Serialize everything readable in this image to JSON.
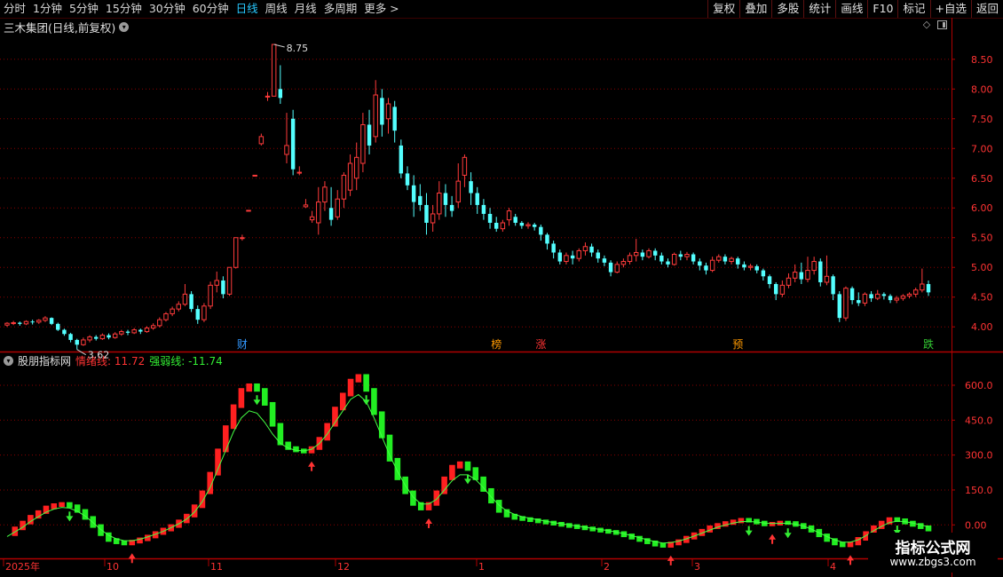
{
  "toolbar": {
    "periods": [
      "分时",
      "1分钟",
      "5分钟",
      "15分钟",
      "30分钟",
      "60分钟",
      "日线",
      "周线",
      "月线",
      "多周期",
      "更多 >"
    ],
    "active_period": "日线",
    "buttons": [
      "复权",
      "叠加",
      "多股",
      "统计",
      "画线",
      "F10",
      "标记",
      "+自选",
      "返回"
    ]
  },
  "main_chart": {
    "title": "三木集团(日线,前复权)",
    "y_ticks": [
      "8.50",
      "8.00",
      "7.50",
      "7.00",
      "6.50",
      "6.00",
      "5.50",
      "5.00",
      "4.50",
      "4.00"
    ],
    "high_label": "8.75",
    "low_label": "3.62",
    "markers": [
      {
        "label": "财",
        "color": "#3399ff"
      },
      {
        "label": "榜",
        "color": "#ff9900"
      },
      {
        "label": "涨",
        "color": "#ff3333"
      },
      {
        "label": "预",
        "color": "#ff9900"
      },
      {
        "label": "跌",
        "color": "#33cc33"
      }
    ],
    "up_color": "#ff3b3b",
    "down_color": "#54ffff"
  },
  "indicator": {
    "name": "股朋指标网",
    "line1_label": "情绪线: 11.72",
    "line2_label": "强弱线: -11.74",
    "y_ticks": [
      "600.0",
      "450.0",
      "300.0",
      "150.0",
      "0.00"
    ],
    "up_color": "#ff2020",
    "down_color": "#22ee22"
  },
  "x_axis_labels": [
    "2025年",
    "10",
    "11",
    "12",
    "1",
    "2",
    "3",
    "4"
  ],
  "watermark": {
    "line1": "指标公式网",
    "line2": "www.zbgs3.com"
  },
  "chart_data": [
    {
      "type": "candlestick",
      "title": "三木集团(日线,前复权)",
      "ylim": [
        3.6,
        8.9
      ],
      "annotations": [
        {
          "text": "8.75",
          "kind": "high"
        },
        {
          "text": "3.62",
          "kind": "low"
        }
      ],
      "points": [
        [
          4.03,
          4.06,
          4.0,
          4.08
        ],
        [
          4.06,
          4.07,
          4.03,
          4.1
        ],
        [
          4.07,
          4.05,
          4.02,
          4.09
        ],
        [
          4.05,
          4.09,
          4.03,
          4.11
        ],
        [
          4.09,
          4.08,
          4.04,
          4.12
        ],
        [
          4.08,
          4.11,
          4.05,
          4.13
        ],
        [
          4.11,
          4.15,
          4.08,
          4.18
        ],
        [
          4.15,
          4.05,
          4.03,
          4.16
        ],
        [
          4.05,
          3.95,
          3.93,
          4.07
        ],
        [
          3.95,
          3.88,
          3.85,
          3.97
        ],
        [
          3.88,
          3.78,
          3.74,
          3.9
        ],
        [
          3.78,
          3.7,
          3.62,
          3.8
        ],
        [
          3.7,
          3.78,
          3.68,
          3.82
        ],
        [
          3.78,
          3.83,
          3.74,
          3.86
        ],
        [
          3.83,
          3.8,
          3.77,
          3.86
        ],
        [
          3.8,
          3.86,
          3.78,
          3.89
        ],
        [
          3.86,
          3.82,
          3.79,
          3.89
        ],
        [
          3.82,
          3.88,
          3.8,
          3.91
        ],
        [
          3.88,
          3.92,
          3.85,
          3.95
        ],
        [
          3.92,
          3.9,
          3.86,
          3.95
        ],
        [
          3.9,
          3.95,
          3.88,
          3.98
        ],
        [
          3.95,
          3.92,
          3.88,
          3.97
        ],
        [
          3.92,
          3.98,
          3.9,
          4.01
        ],
        [
          3.98,
          4.02,
          3.95,
          4.06
        ],
        [
          4.02,
          4.12,
          3.99,
          4.16
        ],
        [
          4.12,
          4.22,
          4.09,
          4.25
        ],
        [
          4.22,
          4.3,
          4.18,
          4.34
        ],
        [
          4.3,
          4.38,
          4.26,
          4.43
        ],
        [
          4.38,
          4.55,
          4.35,
          4.72
        ],
        [
          4.55,
          4.3,
          4.25,
          4.6
        ],
        [
          4.3,
          4.12,
          4.05,
          4.36
        ],
        [
          4.12,
          4.35,
          4.08,
          4.4
        ],
        [
          4.35,
          4.7,
          4.3,
          4.76
        ],
        [
          4.7,
          4.78,
          4.58,
          4.93
        ],
        [
          4.78,
          4.55,
          4.48,
          4.85
        ],
        [
          4.55,
          5.0,
          4.52,
          5.0
        ],
        [
          5.0,
          5.5,
          4.98,
          5.5
        ],
        [
          5.5,
          5.5,
          5.45,
          5.55
        ],
        [
          5.96,
          5.96,
          5.96,
          5.96
        ],
        [
          6.55,
          6.55,
          6.55,
          6.55
        ],
        [
          7.08,
          7.2,
          7.05,
          7.25
        ],
        [
          7.88,
          7.88,
          7.8,
          7.95
        ],
        [
          7.88,
          8.75,
          7.88,
          8.75
        ],
        [
          8.0,
          7.85,
          7.75,
          8.4
        ],
        [
          6.9,
          7.05,
          6.75,
          7.6
        ],
        [
          7.5,
          6.65,
          6.55,
          7.65
        ],
        [
          6.6,
          6.6,
          6.55,
          6.7
        ],
        [
          6.02,
          6.05,
          6.0,
          6.15
        ],
        [
          5.8,
          5.85,
          5.75,
          5.95
        ],
        [
          5.75,
          6.1,
          5.55,
          6.35
        ],
        [
          6.1,
          6.35,
          5.95,
          6.45
        ],
        [
          6.0,
          5.8,
          5.7,
          6.35
        ],
        [
          5.85,
          6.15,
          5.8,
          6.3
        ],
        [
          6.15,
          6.55,
          6.0,
          6.6
        ],
        [
          6.3,
          6.75,
          6.2,
          6.9
        ],
        [
          6.5,
          6.85,
          6.3,
          7.1
        ],
        [
          6.75,
          7.4,
          6.6,
          7.6
        ],
        [
          7.4,
          7.05,
          6.9,
          7.65
        ],
        [
          7.2,
          7.9,
          7.1,
          8.15
        ],
        [
          7.85,
          7.4,
          7.2,
          8.0
        ],
        [
          7.5,
          7.75,
          7.25,
          7.85
        ],
        [
          7.7,
          7.3,
          7.1,
          7.8
        ],
        [
          7.05,
          6.58,
          6.5,
          7.15
        ],
        [
          6.58,
          6.38,
          6.3,
          6.7
        ],
        [
          6.38,
          6.1,
          5.85,
          6.55
        ],
        [
          6.2,
          6.05,
          5.95,
          6.4
        ],
        [
          6.05,
          5.75,
          5.55,
          6.25
        ],
        [
          5.75,
          5.9,
          5.6,
          6.05
        ],
        [
          5.9,
          6.25,
          5.8,
          6.45
        ],
        [
          6.25,
          6.05,
          5.85,
          6.4
        ],
        [
          6.05,
          5.95,
          5.85,
          6.2
        ],
        [
          6.1,
          6.45,
          6.0,
          6.75
        ],
        [
          6.55,
          6.85,
          6.35,
          6.9
        ],
        [
          6.45,
          6.25,
          6.05,
          6.6
        ],
        [
          6.25,
          6.05,
          5.9,
          6.35
        ],
        [
          6.05,
          5.9,
          5.8,
          6.15
        ],
        [
          5.9,
          5.75,
          5.65,
          6.0
        ],
        [
          5.75,
          5.65,
          5.6,
          5.85
        ],
        [
          5.65,
          5.75,
          5.6,
          5.8
        ],
        [
          5.8,
          5.95,
          5.7,
          6.0
        ],
        [
          5.85,
          5.75,
          5.7,
          5.9
        ],
        [
          5.75,
          5.7,
          5.65,
          5.78
        ],
        [
          5.7,
          5.72,
          5.65,
          5.76
        ],
        [
          5.72,
          5.68,
          5.62,
          5.75
        ],
        [
          5.68,
          5.55,
          5.45,
          5.72
        ],
        [
          5.55,
          5.4,
          5.3,
          5.58
        ],
        [
          5.4,
          5.25,
          5.15,
          5.45
        ],
        [
          5.25,
          5.1,
          5.05,
          5.3
        ],
        [
          5.1,
          5.2,
          5.05,
          5.25
        ],
        [
          5.2,
          5.15,
          5.05,
          5.28
        ],
        [
          5.15,
          5.28,
          5.1,
          5.32
        ],
        [
          5.28,
          5.35,
          5.2,
          5.42
        ],
        [
          5.35,
          5.25,
          5.18,
          5.4
        ],
        [
          5.25,
          5.15,
          5.08,
          5.3
        ],
        [
          5.15,
          5.08,
          5.02,
          5.2
        ],
        [
          5.08,
          4.92,
          4.85,
          5.12
        ],
        [
          4.92,
          5.05,
          4.9,
          5.1
        ],
        [
          5.05,
          5.1,
          5.0,
          5.15
        ],
        [
          5.1,
          5.2,
          5.05,
          5.25
        ],
        [
          5.2,
          5.25,
          5.1,
          5.48
        ],
        [
          5.25,
          5.18,
          5.12,
          5.3
        ],
        [
          5.18,
          5.28,
          5.15,
          5.32
        ],
        [
          5.28,
          5.2,
          5.12,
          5.32
        ],
        [
          5.2,
          5.1,
          5.05,
          5.25
        ],
        [
          5.1,
          5.05,
          5.0,
          5.15
        ],
        [
          5.05,
          5.22,
          5.03,
          5.25
        ],
        [
          5.22,
          5.18,
          5.12,
          5.28
        ],
        [
          5.18,
          5.22,
          5.12,
          5.26
        ],
        [
          5.22,
          5.1,
          5.05,
          5.25
        ],
        [
          5.1,
          5.03,
          4.95,
          5.15
        ],
        [
          5.03,
          4.95,
          4.88,
          5.08
        ],
        [
          4.95,
          5.12,
          4.92,
          5.18
        ],
        [
          5.12,
          5.18,
          5.08,
          5.22
        ],
        [
          5.18,
          5.1,
          5.05,
          5.22
        ],
        [
          5.1,
          5.15,
          5.05,
          5.18
        ],
        [
          5.15,
          5.05,
          4.98,
          5.18
        ],
        [
          5.05,
          5.0,
          4.95,
          5.1
        ],
        [
          5.0,
          5.02,
          4.95,
          5.06
        ],
        [
          5.02,
          4.95,
          4.9,
          5.05
        ],
        [
          4.95,
          4.85,
          4.78,
          4.98
        ],
        [
          4.85,
          4.72,
          4.65,
          4.88
        ],
        [
          4.72,
          4.55,
          4.45,
          4.75
        ],
        [
          4.55,
          4.7,
          4.5,
          4.78
        ],
        [
          4.7,
          4.82,
          4.65,
          4.9
        ],
        [
          4.82,
          4.92,
          4.75,
          5.05
        ],
        [
          4.92,
          4.8,
          4.72,
          5.08
        ],
        [
          4.8,
          4.95,
          4.75,
          5.18
        ],
        [
          4.95,
          5.1,
          4.88,
          5.18
        ],
        [
          5.1,
          4.75,
          4.68,
          5.15
        ],
        [
          4.75,
          4.85,
          4.7,
          5.2
        ],
        [
          4.85,
          4.55,
          4.45,
          4.88
        ],
        [
          4.55,
          4.15,
          4.08,
          4.6
        ],
        [
          4.15,
          4.65,
          4.1,
          4.68
        ],
        [
          4.65,
          4.45,
          4.38,
          4.68
        ],
        [
          4.45,
          4.4,
          4.35,
          4.58
        ],
        [
          4.4,
          4.55,
          4.35,
          4.58
        ],
        [
          4.55,
          4.48,
          4.42,
          4.6
        ],
        [
          4.48,
          4.55,
          4.45,
          4.62
        ],
        [
          4.55,
          4.52,
          4.46,
          4.58
        ],
        [
          4.52,
          4.45,
          4.4,
          4.55
        ],
        [
          4.45,
          4.48,
          4.4,
          4.52
        ],
        [
          4.48,
          4.52,
          4.44,
          4.55
        ],
        [
          4.52,
          4.55,
          4.48,
          4.58
        ],
        [
          4.55,
          4.62,
          4.5,
          4.66
        ],
        [
          4.62,
          4.72,
          4.58,
          4.98
        ],
        [
          4.72,
          4.58,
          4.52,
          4.78
        ]
      ]
    },
    {
      "type": "line",
      "title": "股朋指标网",
      "ylim": [
        -140,
        680
      ],
      "series": [
        {
          "name": "情绪线",
          "values": [
            -40,
            -15,
            10,
            35,
            55,
            75,
            85,
            90,
            80,
            60,
            30,
            -5,
            -40,
            -65,
            -75,
            -80,
            -72,
            -62,
            -50,
            -35,
            -20,
            -5,
            15,
            40,
            80,
            140,
            220,
            320,
            420,
            510,
            580,
            600,
            580,
            520,
            430,
            350,
            330,
            320,
            315,
            330,
            370,
            430,
            500,
            560,
            620,
            640,
            580,
            480,
            380,
            280,
            200,
            140,
            90,
            70,
            90,
            140,
            200,
            250,
            265,
            240,
            200,
            150,
            100,
            60,
            40,
            30,
            25,
            20,
            15,
            10,
            5,
            0,
            -5,
            -10,
            -15,
            -20,
            -25,
            -30,
            -35,
            -45,
            -55,
            -65,
            -75,
            -85,
            -90,
            -80,
            -70,
            -55,
            -40,
            -25,
            -10,
            0,
            8,
            15,
            22,
            18,
            10,
            2,
            5,
            10,
            8,
            0,
            -10,
            -25,
            -45,
            -65,
            -80,
            -88,
            -80,
            -60,
            -35,
            -10,
            10,
            25,
            20,
            10,
            0,
            -10,
            -20
          ]
        },
        {
          "name": "强弱线",
          "values": [
            -50,
            -30,
            -10,
            15,
            35,
            55,
            68,
            75,
            72,
            58,
            38,
            10,
            -20,
            -45,
            -60,
            -68,
            -68,
            -62,
            -52,
            -40,
            -28,
            -12,
            5,
            25,
            55,
            100,
            160,
            240,
            320,
            400,
            460,
            490,
            480,
            440,
            390,
            350,
            330,
            320,
            318,
            325,
            350,
            390,
            440,
            490,
            540,
            560,
            530,
            460,
            380,
            300,
            230,
            170,
            120,
            90,
            90,
            110,
            150,
            190,
            215,
            215,
            195,
            160,
            120,
            85,
            60,
            45,
            35,
            28,
            22,
            16,
            10,
            5,
            0,
            -5,
            -10,
            -15,
            -20,
            -25,
            -30,
            -38,
            -46,
            -55,
            -64,
            -72,
            -78,
            -76,
            -70,
            -60,
            -48,
            -35,
            -22,
            -10,
            0,
            8,
            14,
            15,
            12,
            8,
            6,
            7,
            7,
            3,
            -5,
            -18,
            -34,
            -50,
            -64,
            -74,
            -74,
            -64,
            -46,
            -25,
            -6,
            10,
            16,
            14,
            8,
            0,
            -8
          ]
        }
      ]
    }
  ]
}
